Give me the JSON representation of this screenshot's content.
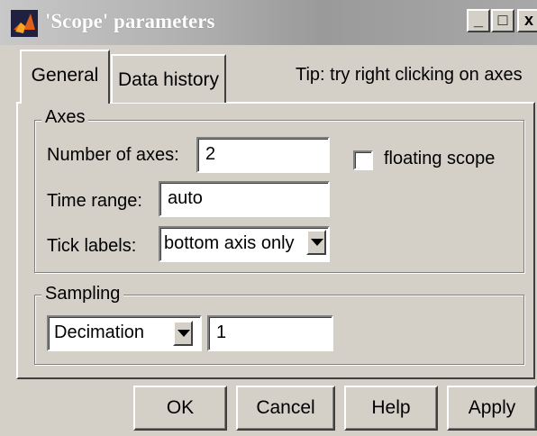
{
  "window": {
    "title": "'Scope' parameters",
    "icon": "matlab-logo-icon",
    "controls": {
      "minimize": "_",
      "maximize": "□",
      "close": "x"
    }
  },
  "tabs": [
    {
      "label": "General",
      "selected": true
    },
    {
      "label": "Data history",
      "selected": false
    }
  ],
  "tip": "Tip: try right clicking on axes",
  "axes": {
    "legend": "Axes",
    "number_of_axes_label": "Number of axes:",
    "number_of_axes_value": "2",
    "floating_scope_label": "floating scope",
    "floating_scope_checked": false,
    "time_range_label": "Time range:",
    "time_range_value": "auto",
    "tick_labels_label": "Tick labels:",
    "tick_labels_value": "bottom axis only"
  },
  "sampling": {
    "legend": "Sampling",
    "mode_value": "Decimation",
    "factor_value": "1"
  },
  "buttons": {
    "ok": "OK",
    "cancel": "Cancel",
    "help": "Help",
    "apply": "Apply"
  },
  "colors": {
    "dialog_bg": "#d4d0c8",
    "title_bar": "#a8a8a8",
    "field_bg": "#ffffff"
  }
}
